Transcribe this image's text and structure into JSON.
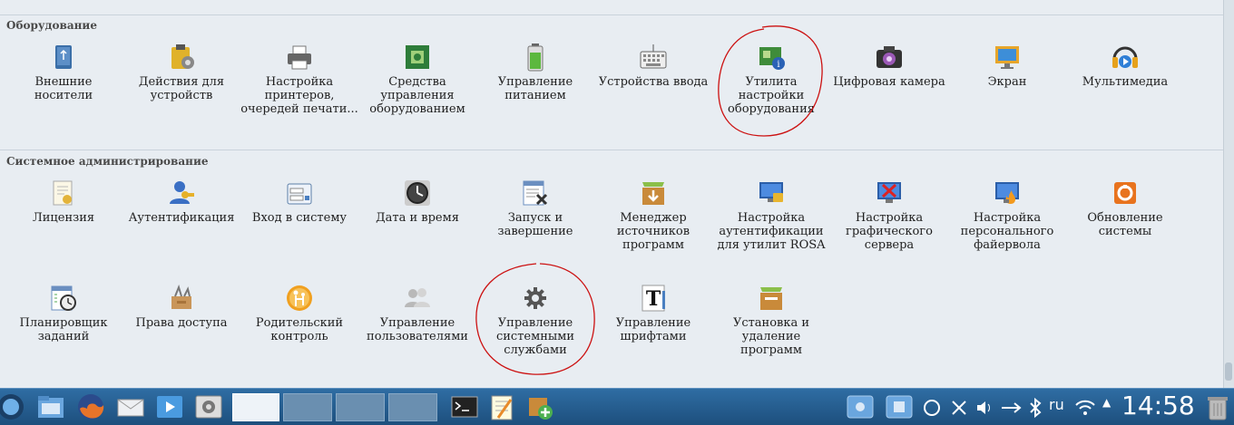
{
  "sections": [
    {
      "title": "Оборудование",
      "items": [
        {
          "label": "Внешние носители",
          "icon": "usb-drive-icon"
        },
        {
          "label": "Действия для устройств",
          "icon": "device-actions-icon"
        },
        {
          "label": "Настройка принтеров, очередей печати...",
          "icon": "printer-icon"
        },
        {
          "label": "Средства управления оборудованием",
          "icon": "hardware-board-icon"
        },
        {
          "label": "Управление питанием",
          "icon": "battery-icon"
        },
        {
          "label": "Устройства ввода",
          "icon": "keyboard-icon"
        },
        {
          "label": "Утилита настройки оборудования",
          "icon": "hardware-info-icon"
        },
        {
          "label": "Цифровая камера",
          "icon": "camera-icon"
        },
        {
          "label": "Экран",
          "icon": "display-icon"
        },
        {
          "label": "Мультимедиа",
          "icon": "multimedia-icon"
        }
      ]
    },
    {
      "title": "Системное администрирование",
      "items": [
        {
          "label": "Лицензия",
          "icon": "license-icon"
        },
        {
          "label": "Аутентификация",
          "icon": "authentication-icon"
        },
        {
          "label": "Вход в систему",
          "icon": "login-icon"
        },
        {
          "label": "Дата и время",
          "icon": "clock-icon"
        },
        {
          "label": "Запуск и завершение",
          "icon": "startup-icon"
        },
        {
          "label": "Менеджер источников программ",
          "icon": "package-sources-icon"
        },
        {
          "label": "Настройка аутентификации для утилит ROSA",
          "icon": "rosa-auth-icon"
        },
        {
          "label": "Настройка графического сервера",
          "icon": "graphics-server-icon"
        },
        {
          "label": "Настройка персонального файервола",
          "icon": "firewall-icon"
        },
        {
          "label": "Обновление системы",
          "icon": "system-update-icon"
        },
        {
          "label": "Планировщик заданий",
          "icon": "task-scheduler-icon"
        },
        {
          "label": "Права доступа",
          "icon": "permissions-icon"
        },
        {
          "label": "Родительский контроль",
          "icon": "parental-control-icon"
        },
        {
          "label": "Управление пользователями",
          "icon": "users-icon"
        },
        {
          "label": "Управление системными службами",
          "icon": "services-gear-icon"
        },
        {
          "label": "Управление шрифтами",
          "icon": "fonts-icon"
        },
        {
          "label": "Установка и удаление программ",
          "icon": "install-remove-icon"
        }
      ]
    }
  ],
  "taskbar": {
    "launchers": [
      "rosa-menu-icon",
      "file-manager-icon",
      "firefox-icon",
      "mail-icon",
      "media-player-icon",
      "system-settings-icon"
    ],
    "pinned": [
      "terminal-icon",
      "notes-icon",
      "package-add-icon"
    ],
    "tray_lang": "ru",
    "clock": "14:58"
  },
  "colors": {
    "annotation_circle": "#cc0000",
    "taskbar": "#2f6da3",
    "background": "#e8edf2"
  }
}
